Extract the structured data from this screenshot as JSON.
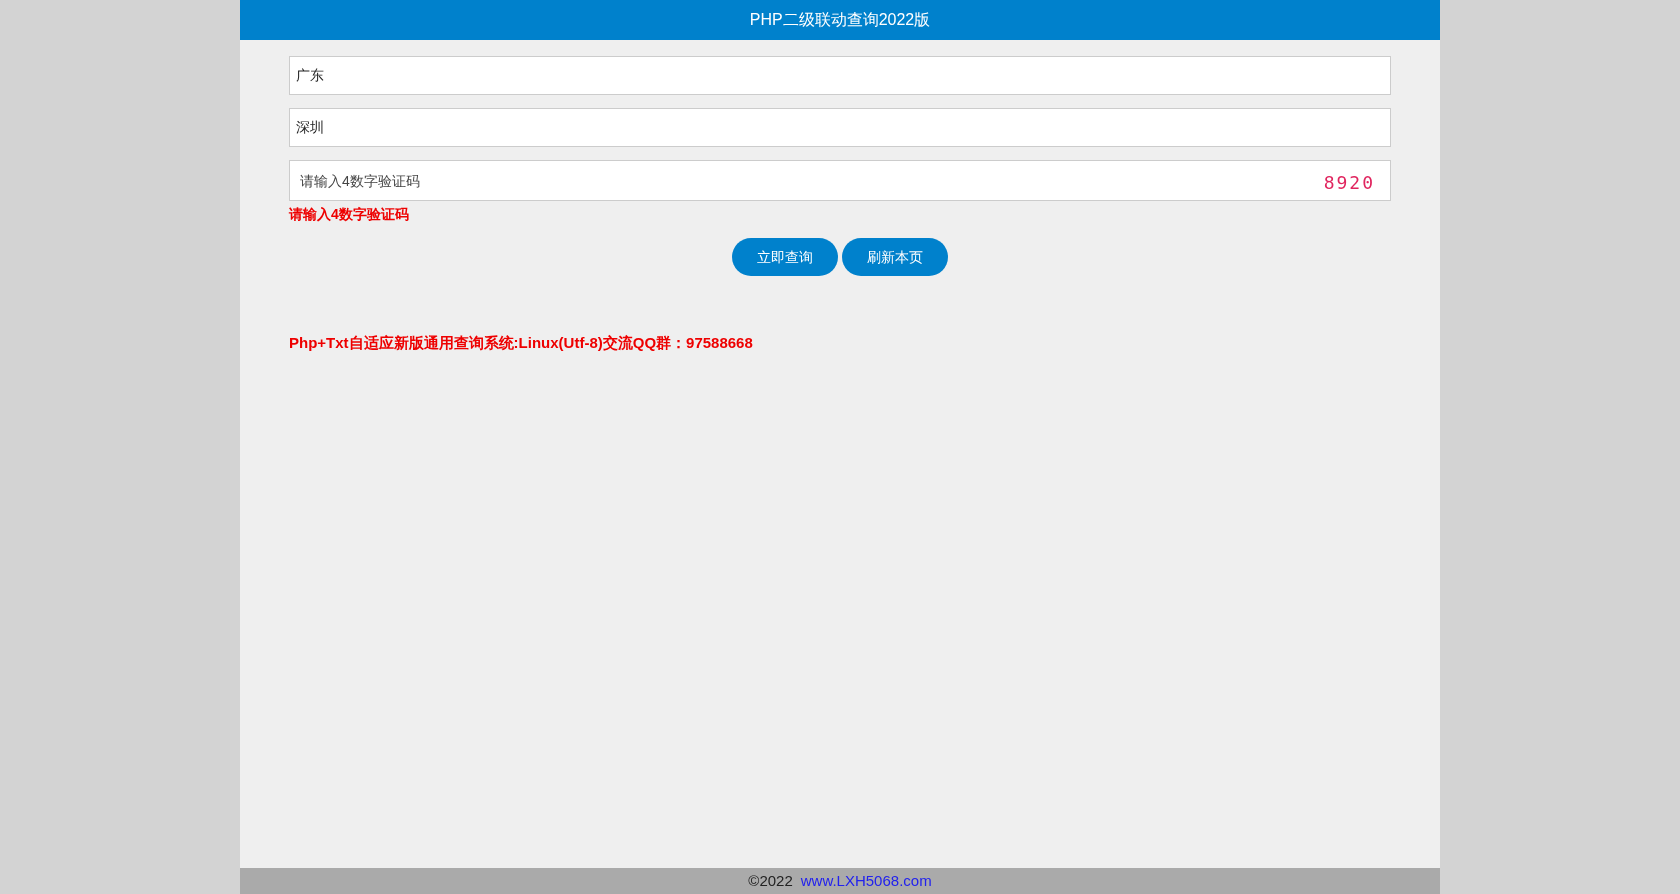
{
  "header": {
    "title": "PHP二级联动查询2022版"
  },
  "fields": [
    {
      "kind": "value",
      "text": "广东"
    },
    {
      "kind": "value",
      "text": "深圳"
    },
    {
      "kind": "captcha",
      "placeholder": "请输入4数字验证码",
      "captcha": "8920"
    }
  ],
  "error": "请输入4数字验证码",
  "buttons": [
    "立即查询",
    "刷新本页"
  ],
  "notice": "Php+Txt自适应新版通用查询系统:Linux(Utf-8)交流QQ群：97588668",
  "footer": {
    "copyright": "©2022",
    "link": "www.LXH5068.com"
  }
}
